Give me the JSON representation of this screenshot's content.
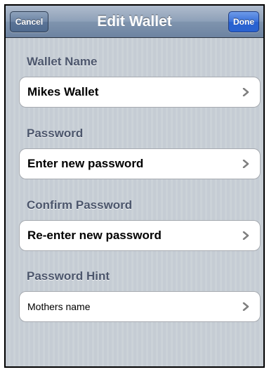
{
  "navbar": {
    "title": "Edit Wallet",
    "cancel_label": "Cancel",
    "done_label": "Done"
  },
  "sections": [
    {
      "header": "Wallet Name",
      "value": "Mikes Wallet"
    },
    {
      "header": "Password",
      "value": "Enter new password"
    },
    {
      "header": "Confirm Password",
      "value": "Re-enter new password"
    },
    {
      "header": "Password Hint",
      "value": "Mothers name"
    }
  ],
  "icons": {
    "disclosure": "chevron-right-icon"
  },
  "colors": {
    "navbar": "#7f94ae",
    "done_button": "#2a62d0",
    "section_label": "#4c566c",
    "background": "#c5ccd4"
  }
}
